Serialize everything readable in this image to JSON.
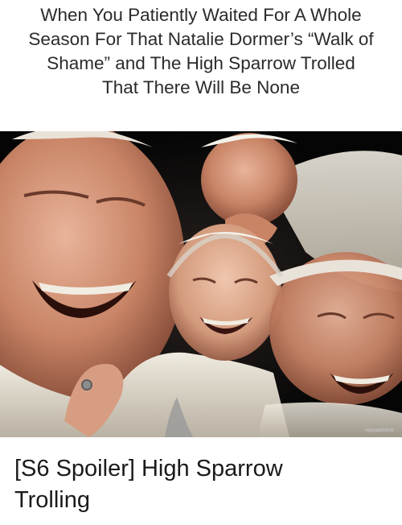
{
  "meme": {
    "caption_lines": [
      "When You Patiently Waited For A Whole",
      "Season For That Natalie Dormer’s “Walk of",
      "Shame” and The High Sparrow Trolled",
      "That There Will Be None"
    ],
    "image_alt": "Collage of a laughing man in white clerical robes and skullcap, shown in four overlapping shots",
    "watermark": "repeatwhitme"
  },
  "post": {
    "title_lines": [
      "[S6 Spoiler] High Sparrow",
      "Trolling"
    ]
  }
}
